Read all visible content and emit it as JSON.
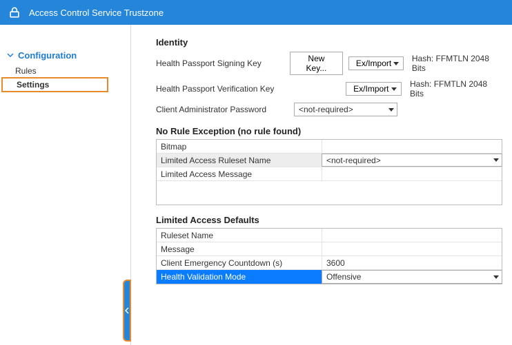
{
  "header": {
    "title": "Access Control Service Trustzone"
  },
  "sidebar": {
    "section": "Configuration",
    "items": [
      "Rules",
      "Settings"
    ],
    "selected": "Settings"
  },
  "identity": {
    "title": "Identity",
    "signing_label": "Health Passport Signing Key",
    "verify_label": "Health Passport Verification Key",
    "admin_label": "Client Administrator Password",
    "new_key_btn": "New Key...",
    "eximport_btn": "Ex/Import",
    "hash_signing": "Hash: FFMTLN 2048 Bits",
    "hash_verify": "Hash: FFMTLN 2048 Bits",
    "admin_value": "<not-required>"
  },
  "no_rule": {
    "title": "No Rule Exception (no rule found)",
    "bitmap_label": "Bitmap",
    "ruleset_label": "Limited Access Ruleset Name",
    "ruleset_value": "<not-required>",
    "message_label": "Limited Access Message"
  },
  "defaults": {
    "title": "Limited Access Defaults",
    "ruleset_label": "Ruleset Name",
    "message_label": "Message",
    "countdown_label": "Client Emergency Countdown (s)",
    "countdown_value": "3600",
    "mode_label": "Health Validation Mode",
    "mode_value": "Offensive"
  }
}
